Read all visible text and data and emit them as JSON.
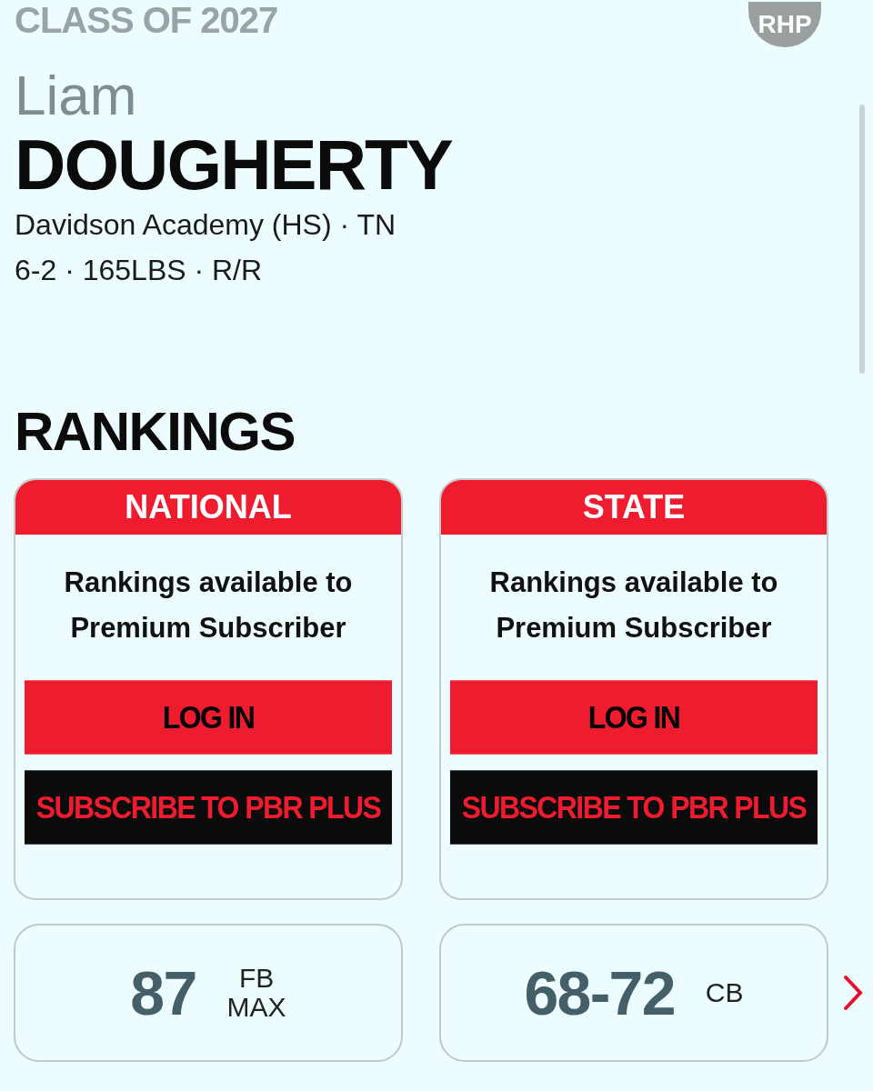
{
  "header": {
    "class_label": "CLASS OF 2027",
    "position_badge": "RHP"
  },
  "player": {
    "first_name": "Liam",
    "last_name": "DOUGHERTY",
    "school": "Davidson Academy (HS) · TN",
    "measurables": "6-2 · 165LBS · R/R"
  },
  "rankings": {
    "title": "RANKINGS",
    "cards": [
      {
        "heading": "NATIONAL",
        "message": "Rankings available to Premium Subscriber",
        "buttons": [
          {
            "label": "LOG IN",
            "kind": "primary"
          },
          {
            "label": "SUBSCRIBE TO PBR PLUS",
            "kind": "dark"
          }
        ]
      },
      {
        "heading": "STATE",
        "message": "Rankings available to Premium Subscriber",
        "buttons": [
          {
            "label": "LOG IN",
            "kind": "primary"
          },
          {
            "label": "SUBSCRIBE TO PBR PLUS",
            "kind": "dark"
          }
        ]
      }
    ]
  },
  "stats": [
    {
      "value": "87",
      "label_lines": [
        "FB",
        "MAX"
      ]
    },
    {
      "value": "68-72",
      "label_lines": [
        "CB"
      ]
    }
  ]
}
